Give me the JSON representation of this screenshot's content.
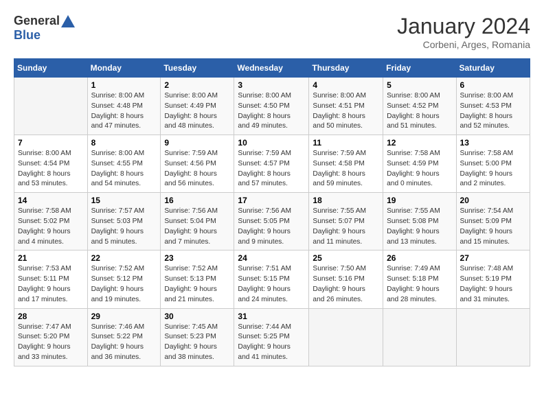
{
  "header": {
    "logo_general": "General",
    "logo_blue": "Blue",
    "month_title": "January 2024",
    "location": "Corbeni, Arges, Romania"
  },
  "weekdays": [
    "Sunday",
    "Monday",
    "Tuesday",
    "Wednesday",
    "Thursday",
    "Friday",
    "Saturday"
  ],
  "weeks": [
    [
      {
        "day": "",
        "info": ""
      },
      {
        "day": "1",
        "info": "Sunrise: 8:00 AM\nSunset: 4:48 PM\nDaylight: 8 hours\nand 47 minutes."
      },
      {
        "day": "2",
        "info": "Sunrise: 8:00 AM\nSunset: 4:49 PM\nDaylight: 8 hours\nand 48 minutes."
      },
      {
        "day": "3",
        "info": "Sunrise: 8:00 AM\nSunset: 4:50 PM\nDaylight: 8 hours\nand 49 minutes."
      },
      {
        "day": "4",
        "info": "Sunrise: 8:00 AM\nSunset: 4:51 PM\nDaylight: 8 hours\nand 50 minutes."
      },
      {
        "day": "5",
        "info": "Sunrise: 8:00 AM\nSunset: 4:52 PM\nDaylight: 8 hours\nand 51 minutes."
      },
      {
        "day": "6",
        "info": "Sunrise: 8:00 AM\nSunset: 4:53 PM\nDaylight: 8 hours\nand 52 minutes."
      }
    ],
    [
      {
        "day": "7",
        "info": "Sunrise: 8:00 AM\nSunset: 4:54 PM\nDaylight: 8 hours\nand 53 minutes."
      },
      {
        "day": "8",
        "info": "Sunrise: 8:00 AM\nSunset: 4:55 PM\nDaylight: 8 hours\nand 54 minutes."
      },
      {
        "day": "9",
        "info": "Sunrise: 7:59 AM\nSunset: 4:56 PM\nDaylight: 8 hours\nand 56 minutes."
      },
      {
        "day": "10",
        "info": "Sunrise: 7:59 AM\nSunset: 4:57 PM\nDaylight: 8 hours\nand 57 minutes."
      },
      {
        "day": "11",
        "info": "Sunrise: 7:59 AM\nSunset: 4:58 PM\nDaylight: 8 hours\nand 59 minutes."
      },
      {
        "day": "12",
        "info": "Sunrise: 7:58 AM\nSunset: 4:59 PM\nDaylight: 9 hours\nand 0 minutes."
      },
      {
        "day": "13",
        "info": "Sunrise: 7:58 AM\nSunset: 5:00 PM\nDaylight: 9 hours\nand 2 minutes."
      }
    ],
    [
      {
        "day": "14",
        "info": "Sunrise: 7:58 AM\nSunset: 5:02 PM\nDaylight: 9 hours\nand 4 minutes."
      },
      {
        "day": "15",
        "info": "Sunrise: 7:57 AM\nSunset: 5:03 PM\nDaylight: 9 hours\nand 5 minutes."
      },
      {
        "day": "16",
        "info": "Sunrise: 7:56 AM\nSunset: 5:04 PM\nDaylight: 9 hours\nand 7 minutes."
      },
      {
        "day": "17",
        "info": "Sunrise: 7:56 AM\nSunset: 5:05 PM\nDaylight: 9 hours\nand 9 minutes."
      },
      {
        "day": "18",
        "info": "Sunrise: 7:55 AM\nSunset: 5:07 PM\nDaylight: 9 hours\nand 11 minutes."
      },
      {
        "day": "19",
        "info": "Sunrise: 7:55 AM\nSunset: 5:08 PM\nDaylight: 9 hours\nand 13 minutes."
      },
      {
        "day": "20",
        "info": "Sunrise: 7:54 AM\nSunset: 5:09 PM\nDaylight: 9 hours\nand 15 minutes."
      }
    ],
    [
      {
        "day": "21",
        "info": "Sunrise: 7:53 AM\nSunset: 5:11 PM\nDaylight: 9 hours\nand 17 minutes."
      },
      {
        "day": "22",
        "info": "Sunrise: 7:52 AM\nSunset: 5:12 PM\nDaylight: 9 hours\nand 19 minutes."
      },
      {
        "day": "23",
        "info": "Sunrise: 7:52 AM\nSunset: 5:13 PM\nDaylight: 9 hours\nand 21 minutes."
      },
      {
        "day": "24",
        "info": "Sunrise: 7:51 AM\nSunset: 5:15 PM\nDaylight: 9 hours\nand 24 minutes."
      },
      {
        "day": "25",
        "info": "Sunrise: 7:50 AM\nSunset: 5:16 PM\nDaylight: 9 hours\nand 26 minutes."
      },
      {
        "day": "26",
        "info": "Sunrise: 7:49 AM\nSunset: 5:18 PM\nDaylight: 9 hours\nand 28 minutes."
      },
      {
        "day": "27",
        "info": "Sunrise: 7:48 AM\nSunset: 5:19 PM\nDaylight: 9 hours\nand 31 minutes."
      }
    ],
    [
      {
        "day": "28",
        "info": "Sunrise: 7:47 AM\nSunset: 5:20 PM\nDaylight: 9 hours\nand 33 minutes."
      },
      {
        "day": "29",
        "info": "Sunrise: 7:46 AM\nSunset: 5:22 PM\nDaylight: 9 hours\nand 36 minutes."
      },
      {
        "day": "30",
        "info": "Sunrise: 7:45 AM\nSunset: 5:23 PM\nDaylight: 9 hours\nand 38 minutes."
      },
      {
        "day": "31",
        "info": "Sunrise: 7:44 AM\nSunset: 5:25 PM\nDaylight: 9 hours\nand 41 minutes."
      },
      {
        "day": "",
        "info": ""
      },
      {
        "day": "",
        "info": ""
      },
      {
        "day": "",
        "info": ""
      }
    ]
  ]
}
